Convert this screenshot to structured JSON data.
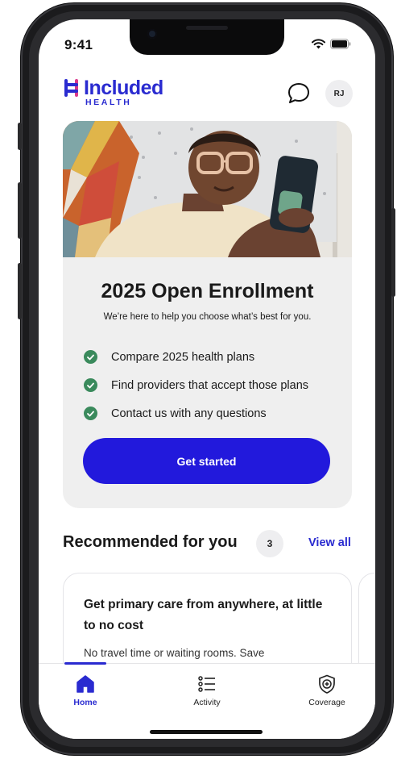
{
  "status_bar": {
    "time": "9:41"
  },
  "header": {
    "logo_title": "Included",
    "logo_subtitle": "HEALTH",
    "avatar_initials": "RJ"
  },
  "enrollment_card": {
    "title": "2025 Open Enrollment",
    "subtitle": "We’re here to help you choose what’s best for you.",
    "checklist": [
      "Compare 2025 health plans",
      "Find providers that accept those plans",
      "Contact us with any questions"
    ],
    "cta_label": "Get started"
  },
  "recommended": {
    "title": "Recommended for you",
    "count": "3",
    "view_all": "View all",
    "card": {
      "heading": "Get primary care from anywhere, at little to no cost",
      "body": "No travel time or waiting rooms. Save"
    }
  },
  "tabs": [
    {
      "label": "Home",
      "icon": "home-icon",
      "active": true
    },
    {
      "label": "Activity",
      "icon": "list-icon",
      "active": false
    },
    {
      "label": "Coverage",
      "icon": "shield-plus-icon",
      "active": false
    }
  ],
  "colors": {
    "brand": "#2a2bd0",
    "cta": "#2219dc",
    "check": "#3a8a5c",
    "card_bg": "#efefef"
  }
}
